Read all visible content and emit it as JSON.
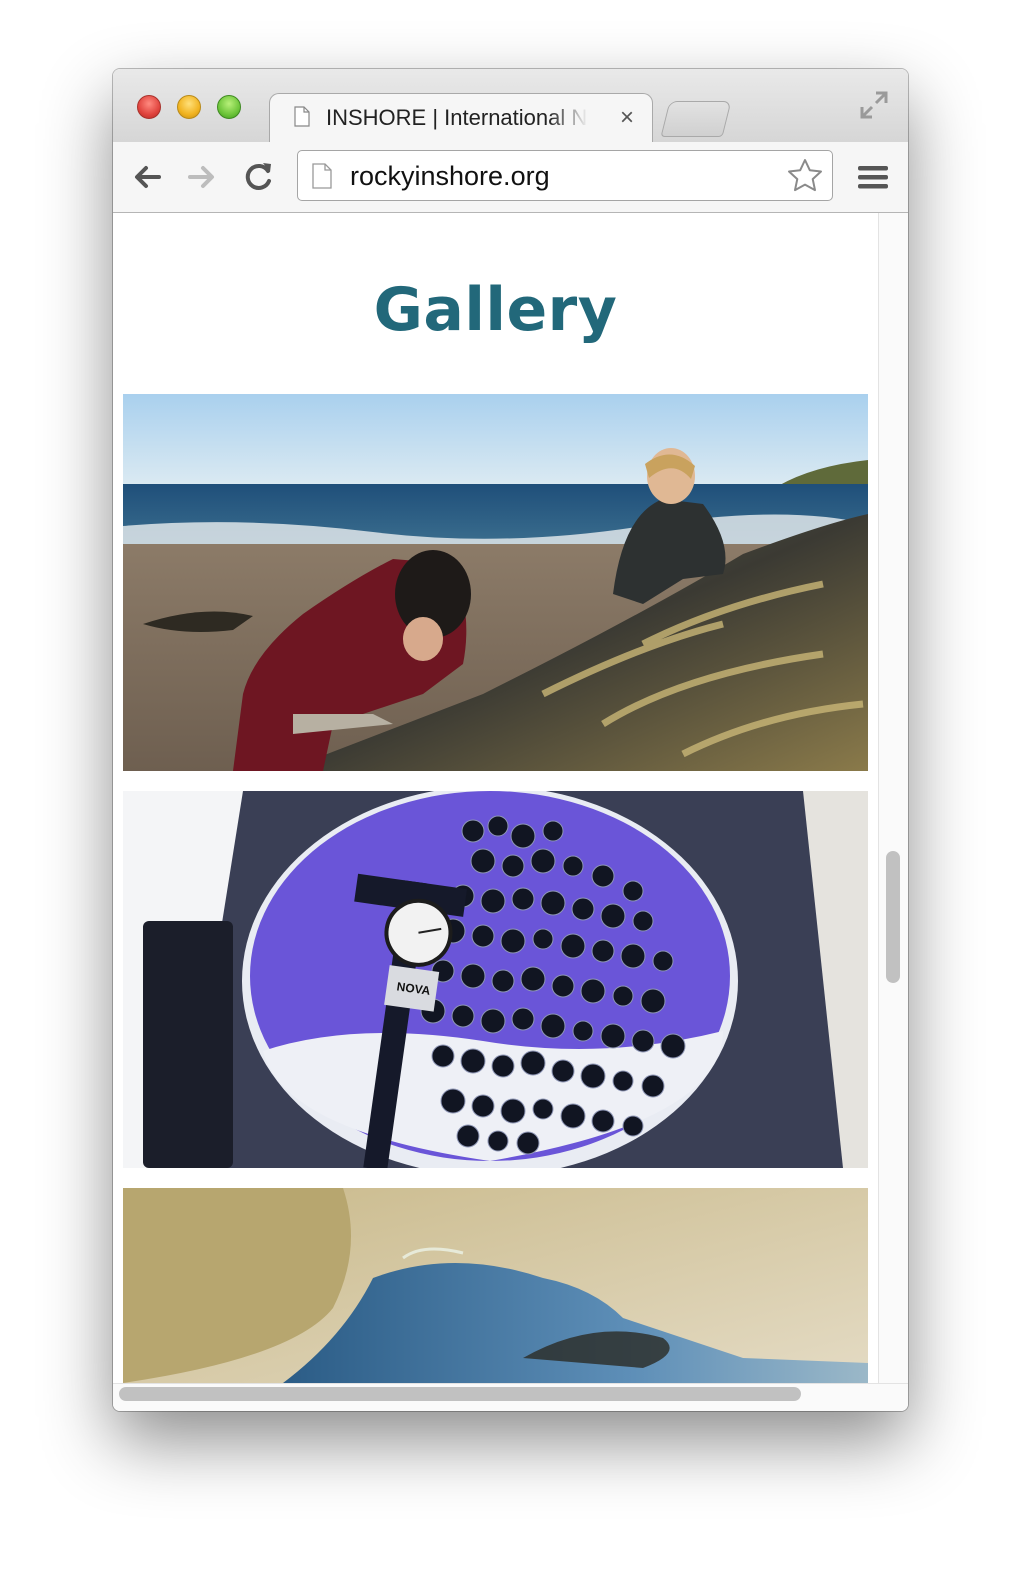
{
  "browser": {
    "tab_title": "INSHORE | International Network",
    "close_glyph": "×",
    "url": "rockyinshore.org"
  },
  "page": {
    "heading": "Gallery",
    "gallery": [
      {
        "subject": "beach-survey-photo"
      },
      {
        "subject": "snails-and-caliper-photo"
      },
      {
        "subject": "rock-pool-photo"
      }
    ],
    "caliper_brand": "NOVA"
  },
  "colors": {
    "heading": "#22687a",
    "scrollbar_thumb": "#c1c1c1"
  }
}
